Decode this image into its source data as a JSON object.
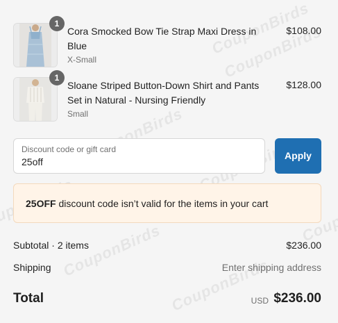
{
  "cart": {
    "items": [
      {
        "title": "Cora Smocked Bow Tie Strap Maxi Dress in Blue",
        "variant": "X-Small",
        "price": "$108.00",
        "quantity": "1",
        "image_icon": "blue-maxi-dress-thumbnail"
      },
      {
        "title": "Sloane Striped Button-Down Shirt and Pants Set in Natural - Nursing Friendly",
        "variant": "Small",
        "price": "$128.00",
        "quantity": "1",
        "image_icon": "striped-shirt-pants-thumbnail"
      }
    ]
  },
  "discount": {
    "label": "Discount code or gift card",
    "value": "25off",
    "apply_label": "Apply"
  },
  "error": {
    "code": "25OFF",
    "message": " discount code isn’t valid for the items in your cart"
  },
  "summary": {
    "subtotal_label": "Subtotal · 2 items",
    "subtotal_value": "$236.00",
    "shipping_label": "Shipping",
    "shipping_value": "Enter shipping address",
    "total_label": "Total",
    "total_currency": "USD",
    "total_value": "$236.00"
  },
  "watermark": {
    "text": "CouponBirds"
  },
  "colors": {
    "accent": "#1f6fb2",
    "error_background": "#fff4e8",
    "page_background": "#f5f5f5"
  }
}
